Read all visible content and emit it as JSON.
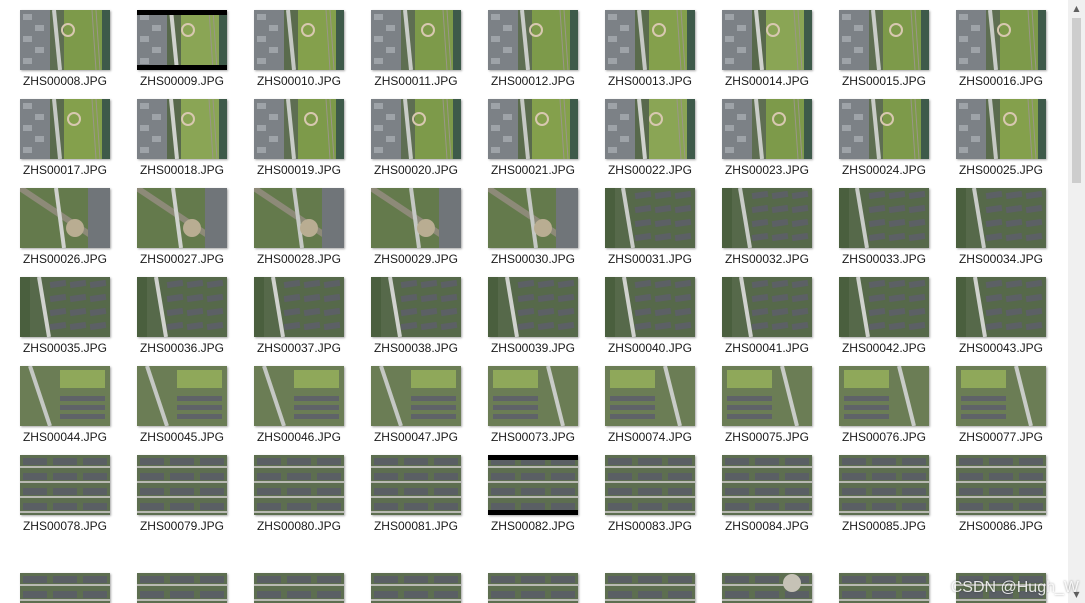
{
  "files": [
    {
      "name": "ZHS00008.JPG",
      "variant": 0
    },
    {
      "name": "ZHS00009.JPG",
      "variant": 1,
      "letterbox": true
    },
    {
      "name": "ZHS00010.JPG",
      "variant": 2
    },
    {
      "name": "ZHS00011.JPG",
      "variant": 3
    },
    {
      "name": "ZHS00012.JPG",
      "variant": 0
    },
    {
      "name": "ZHS00013.JPG",
      "variant": 2
    },
    {
      "name": "ZHS00014.JPG",
      "variant": 1
    },
    {
      "name": "ZHS00015.JPG",
      "variant": 3
    },
    {
      "name": "ZHS00016.JPG",
      "variant": 0
    },
    {
      "name": "ZHS00017.JPG",
      "variant": 2
    },
    {
      "name": "ZHS00018.JPG",
      "variant": 1
    },
    {
      "name": "ZHS00019.JPG",
      "variant": 3
    },
    {
      "name": "ZHS00020.JPG",
      "variant": 0
    },
    {
      "name": "ZHS00021.JPG",
      "variant": 2
    },
    {
      "name": "ZHS00022.JPG",
      "variant": 1
    },
    {
      "name": "ZHS00023.JPG",
      "variant": 3
    },
    {
      "name": "ZHS00024.JPG",
      "variant": 0
    },
    {
      "name": "ZHS00025.JPG",
      "variant": 2
    },
    {
      "name": "ZHS00026.JPG",
      "variant": 4
    },
    {
      "name": "ZHS00027.JPG",
      "variant": 4
    },
    {
      "name": "ZHS00028.JPG",
      "variant": 5
    },
    {
      "name": "ZHS00029.JPG",
      "variant": 5
    },
    {
      "name": "ZHS00030.JPG",
      "variant": 5
    },
    {
      "name": "ZHS00031.JPG",
      "variant": 6
    },
    {
      "name": "ZHS00032.JPG",
      "variant": 6
    },
    {
      "name": "ZHS00033.JPG",
      "variant": 6
    },
    {
      "name": "ZHS00034.JPG",
      "variant": 6
    },
    {
      "name": "ZHS00035.JPG",
      "variant": 7
    },
    {
      "name": "ZHS00036.JPG",
      "variant": 7
    },
    {
      "name": "ZHS00037.JPG",
      "variant": 7
    },
    {
      "name": "ZHS00038.JPG",
      "variant": 7
    },
    {
      "name": "ZHS00039.JPG",
      "variant": 7
    },
    {
      "name": "ZHS00040.JPG",
      "variant": 7
    },
    {
      "name": "ZHS00041.JPG",
      "variant": 7
    },
    {
      "name": "ZHS00042.JPG",
      "variant": 7
    },
    {
      "name": "ZHS00043.JPG",
      "variant": 7
    },
    {
      "name": "ZHS00044.JPG",
      "variant": 8
    },
    {
      "name": "ZHS00045.JPG",
      "variant": 8
    },
    {
      "name": "ZHS00046.JPG",
      "variant": 8
    },
    {
      "name": "ZHS00047.JPG",
      "variant": 8
    },
    {
      "name": "ZHS00073.JPG",
      "variant": 9
    },
    {
      "name": "ZHS00074.JPG",
      "variant": 9
    },
    {
      "name": "ZHS00075.JPG",
      "variant": 9
    },
    {
      "name": "ZHS00076.JPG",
      "variant": 9
    },
    {
      "name": "ZHS00077.JPG",
      "variant": 9
    },
    {
      "name": "ZHS00078.JPG",
      "variant": 10
    },
    {
      "name": "ZHS00079.JPG",
      "variant": 10
    },
    {
      "name": "ZHS00080.JPG",
      "variant": 10
    },
    {
      "name": "ZHS00081.JPG",
      "variant": 10
    },
    {
      "name": "ZHS00082.JPG",
      "variant": 10,
      "letterbox": true
    },
    {
      "name": "ZHS00083.JPG",
      "variant": 10
    },
    {
      "name": "ZHS00084.JPG",
      "variant": 10
    },
    {
      "name": "ZHS00085.JPG",
      "variant": 10
    },
    {
      "name": "ZHS00086.JPG",
      "variant": 10
    }
  ],
  "partial_row_variants": [
    10,
    10,
    10,
    10,
    10,
    10,
    11,
    10,
    10
  ],
  "scrollbar": {
    "up_icon": "scroll-up-arrow-icon",
    "down_icon": "scroll-down-arrow-icon"
  },
  "watermark": "CSDN @Hugh_W",
  "colors": {
    "background": "#ffffff",
    "label_text": "#1a1a1a",
    "scrollbar_track": "#f0f0f0",
    "scrollbar_thumb": "#cdcdcd"
  }
}
